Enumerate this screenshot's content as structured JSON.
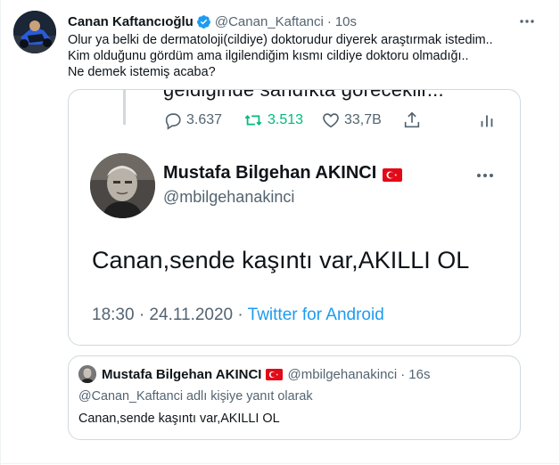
{
  "tweet": {
    "author_name": "Canan Kaftancıoğlu",
    "author_handle": "@Canan_Kaftanci",
    "separator": "·",
    "time": "10s",
    "body_lines": [
      "Olur ya belki de dermatoloji(cildiye) doktorudur diyerek araştırmak istedim..",
      "Kim olduğunu gördüm ama ilgilendiğim kısmı cildiye doktoru olmadığı..",
      "Ne demek istemiş acaba?"
    ]
  },
  "image": {
    "cut_text": "geldiğinde sandıkta göreceklir...",
    "actions": {
      "replies": "3.637",
      "retweets": "3.513",
      "likes": "33,7B"
    },
    "inner_tweet": {
      "author_name": "Mustafa Bilgehan AKINCI",
      "author_handle": "@mbilgehanakinci",
      "text": "Canan,sende kaşıntı var,AKILLI OL",
      "timestamp": "18:30 · 24.11.2020 · ",
      "source": "Twitter for Android"
    }
  },
  "quote": {
    "author_name": "Mustafa Bilgehan AKINCI",
    "author_handle": "@mbilgehanakinci",
    "separator": "·",
    "time": "16s",
    "reply_to": "@Canan_Kaftanci adlı kişiye yanıt olarak",
    "text": "Canan,sende kaşıntı var,AKILLI OL"
  },
  "colors": {
    "accent": "#1d9bf0",
    "retweet_green": "#00ba7c",
    "muted": "#536471",
    "border": "#cfd9de"
  },
  "icons": [
    "verified-badge-icon",
    "more-icon",
    "reply-icon",
    "retweet-icon",
    "like-icon",
    "share-icon",
    "stats-icon",
    "turkish-flag-icon"
  ]
}
